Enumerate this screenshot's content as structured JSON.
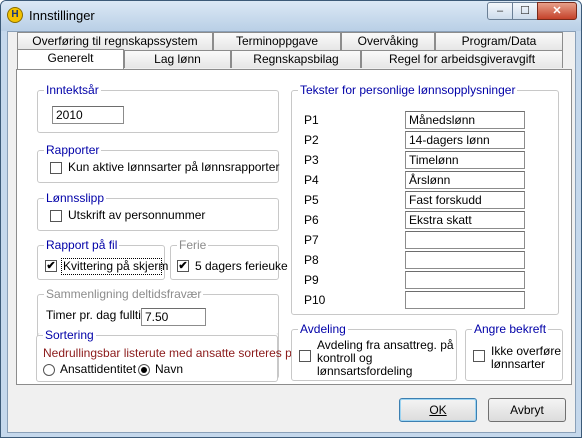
{
  "window": {
    "title": "Innstillinger",
    "icon_glyph": "H",
    "minimize": "–",
    "maximize": "☐",
    "close": "✕"
  },
  "tabs_back": [
    "Overføring til regnskapssystem",
    "Terminoppgave",
    "Overvåking",
    "Program/Data"
  ],
  "tabs_front": [
    "Generelt",
    "Lag lønn",
    "Regnskapsbilag",
    "Regel for arbeidsgiveravgift"
  ],
  "active_tab": "Generelt",
  "inntektsar": {
    "legend": "Inntektsår",
    "value": "2010"
  },
  "rapporter": {
    "legend": "Rapporter",
    "checkbox_label": "Kun aktive lønnsarter på lønnsrapporter",
    "checked": false
  },
  "lonnsslipp": {
    "legend": "Lønnsslipp",
    "checkbox_label": "Utskrift av personnummer",
    "checked": false
  },
  "rapport_pa_fil": {
    "legend": "Rapport på fil",
    "checkbox_label": "Kvittering på skjerm",
    "checked": true
  },
  "ferie": {
    "legend": "Ferie",
    "checkbox_label": "5 dagers ferieuke",
    "checked": true
  },
  "sammenligning": {
    "legend": "Sammenligning deltidsfravær",
    "label": "Timer pr. dag fulltid",
    "value": "7.50"
  },
  "sortering": {
    "legend": "Sortering",
    "description": "Nedrullingsbar listerute med ansatte sorteres på",
    "options": [
      "Ansattidentitet",
      "Navn"
    ],
    "selected": "Navn"
  },
  "tekster": {
    "legend": "Tekster for personlige lønnsopplysninger",
    "rows": [
      {
        "label": "P1",
        "value": "Månedslønn"
      },
      {
        "label": "P2",
        "value": "14-dagers lønn"
      },
      {
        "label": "P3",
        "value": "Timelønn"
      },
      {
        "label": "P4",
        "value": "Årslønn"
      },
      {
        "label": "P5",
        "value": "Fast forskudd"
      },
      {
        "label": "P6",
        "value": "Ekstra skatt"
      },
      {
        "label": "P7",
        "value": ""
      },
      {
        "label": "P8",
        "value": ""
      },
      {
        "label": "P9",
        "value": ""
      },
      {
        "label": "P10",
        "value": ""
      }
    ]
  },
  "avdeling": {
    "legend": "Avdeling",
    "checkbox_label_lines": [
      "Avdeling fra ansattreg. på",
      "kontroll og",
      "lønnsartsfordeling"
    ],
    "checked": false
  },
  "angre": {
    "legend": "Angre bekreft",
    "checkbox_label_lines": [
      "Ikke overføre",
      "lønnsarter"
    ],
    "checked": false
  },
  "buttons": {
    "ok": "OK",
    "cancel": "Avbryt"
  },
  "check_glyph": "✔"
}
